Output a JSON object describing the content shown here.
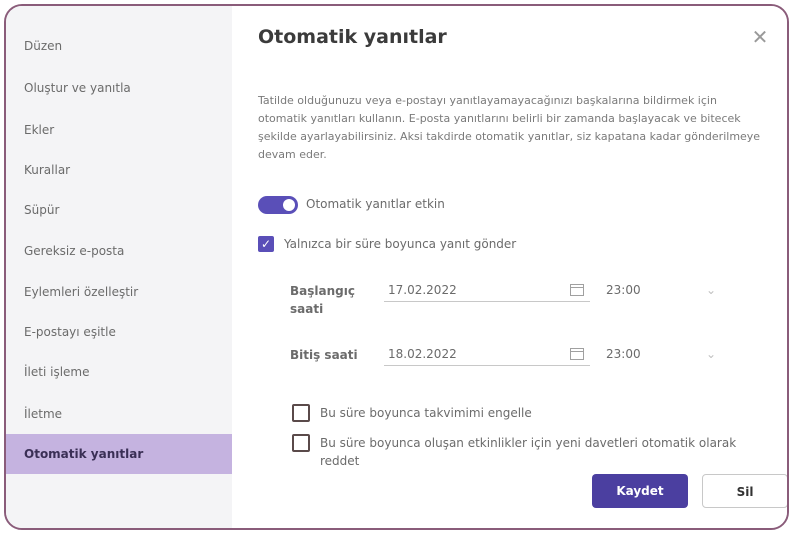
{
  "sidebar": {
    "items": [
      {
        "label": "Düzen"
      },
      {
        "label": "Oluştur ve yanıtla"
      },
      {
        "label": "Ekler"
      },
      {
        "label": "Kurallar"
      },
      {
        "label": "Süpür"
      },
      {
        "label": "Gereksiz e-posta"
      },
      {
        "label": "Eylemleri özelleştir"
      },
      {
        "label": "E-postayı eşitle"
      },
      {
        "label": "İleti işleme"
      },
      {
        "label": "İletme"
      },
      {
        "label": "Otomatik yanıtlar"
      }
    ],
    "active_index": 10
  },
  "panel": {
    "title": "Otomatik yanıtlar",
    "close_glyph": "✕",
    "description": "Tatilde olduğunuzu veya e-postayı yanıtlayamayacağınızı başkalarına bildirmek için otomatik yanıtları kullanın. E-posta yanıtlarını belirli bir zamanda başlayacak ve bitecek şekilde ayarlayabilirsiniz. Aksi takdirde otomatik yanıtlar, siz kapatana kadar gönderilmeye devam eder.",
    "toggle": {
      "label": "Otomatik yanıtlar etkin",
      "on": true
    },
    "time_range_checkbox": {
      "label": "Yalnızca bir süre boyunca yanıt gönder",
      "checked": true
    },
    "start": {
      "label": "Başlangıç saati",
      "date": "17.02.2022",
      "time": "23:00"
    },
    "end": {
      "label": "Bitiş saati",
      "date": "18.02.2022",
      "time": "23:00"
    },
    "block_calendar": {
      "label": "Bu süre boyunca takvimimi engelle",
      "checked": false
    },
    "decline_invites": {
      "label": "Bu süre boyunca oluşan etkinlikler için yeni davetleri otomatik olarak reddet",
      "checked": false
    },
    "save_label": "Kaydet",
    "discard_label": "Sil"
  },
  "colors": {
    "accent": "#5a4fb8",
    "active_item": "#c5b3e0",
    "frame": "#8a5c7a"
  }
}
